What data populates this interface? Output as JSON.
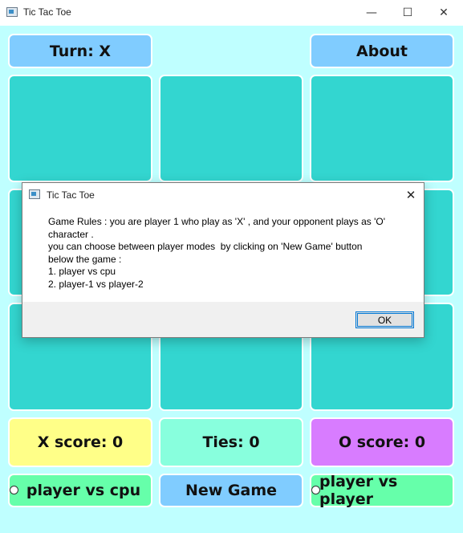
{
  "window": {
    "title": "Tic Tac Toe",
    "minimize": "—",
    "maximize": "☐",
    "close": "✕"
  },
  "header": {
    "turn_label": "Turn: X",
    "about_label": "About"
  },
  "board": {
    "cells": [
      "",
      "",
      "",
      "",
      "",
      "",
      "",
      "",
      ""
    ]
  },
  "scores": {
    "x_score": "X score: 0",
    "ties": "Ties: 0",
    "o_score": "O score: 0"
  },
  "controls": {
    "mode_cpu": "player vs cpu",
    "new_game": "New Game",
    "mode_player": "player vs player"
  },
  "dialog": {
    "title": "Tic Tac Toe",
    "close": "✕",
    "lines": [
      "Game Rules : you are player 1 who play as 'X' , and your opponent plays as 'O'",
      "character .",
      "you can choose between player modes  by clicking on 'New Game' button",
      "below the game :",
      "1. player vs cpu",
      "2. player-1 vs player-2"
    ],
    "ok_label": "OK"
  },
  "colors": {
    "background": "#bfffff",
    "cell": "#33d6d0",
    "turn_button": "#80ccff",
    "x_score": "#ffff88",
    "ties": "#88ffdd",
    "o_score": "#d87cff",
    "mode_button": "#66ffaa"
  }
}
